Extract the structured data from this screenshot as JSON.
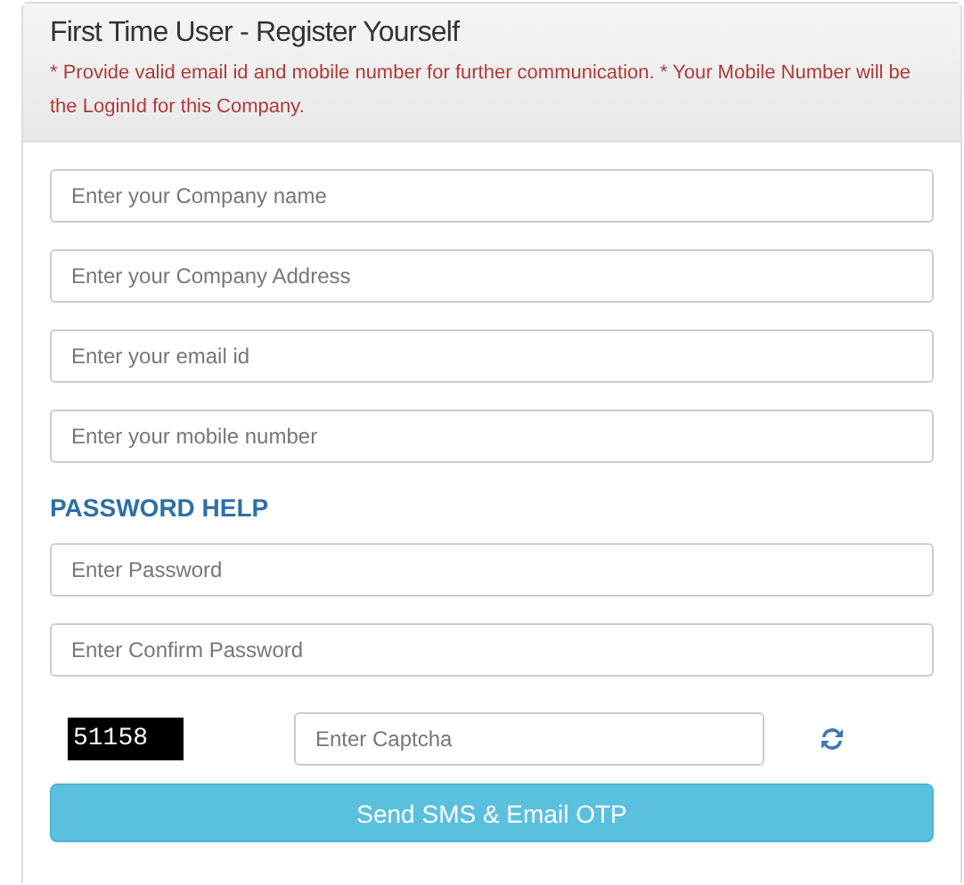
{
  "panel": {
    "title": "First Time User - Register Yourself",
    "notice": "* Provide valid email id and mobile number for further communication. * Your Mobile Number will be the LoginId for this Company."
  },
  "fields": [
    {
      "placeholder": "Enter your Company name"
    },
    {
      "placeholder": "Enter your Company Address"
    },
    {
      "placeholder": "Enter your email id"
    },
    {
      "placeholder": "Enter your mobile number"
    }
  ],
  "password_help": "PASSWORD HELP",
  "password_fields": [
    {
      "placeholder": "Enter Password"
    },
    {
      "placeholder": "Enter Confirm Password"
    }
  ],
  "captcha": {
    "code": "51158",
    "placeholder": "Enter Captcha"
  },
  "submit_button": "Send SMS & Email OTP"
}
